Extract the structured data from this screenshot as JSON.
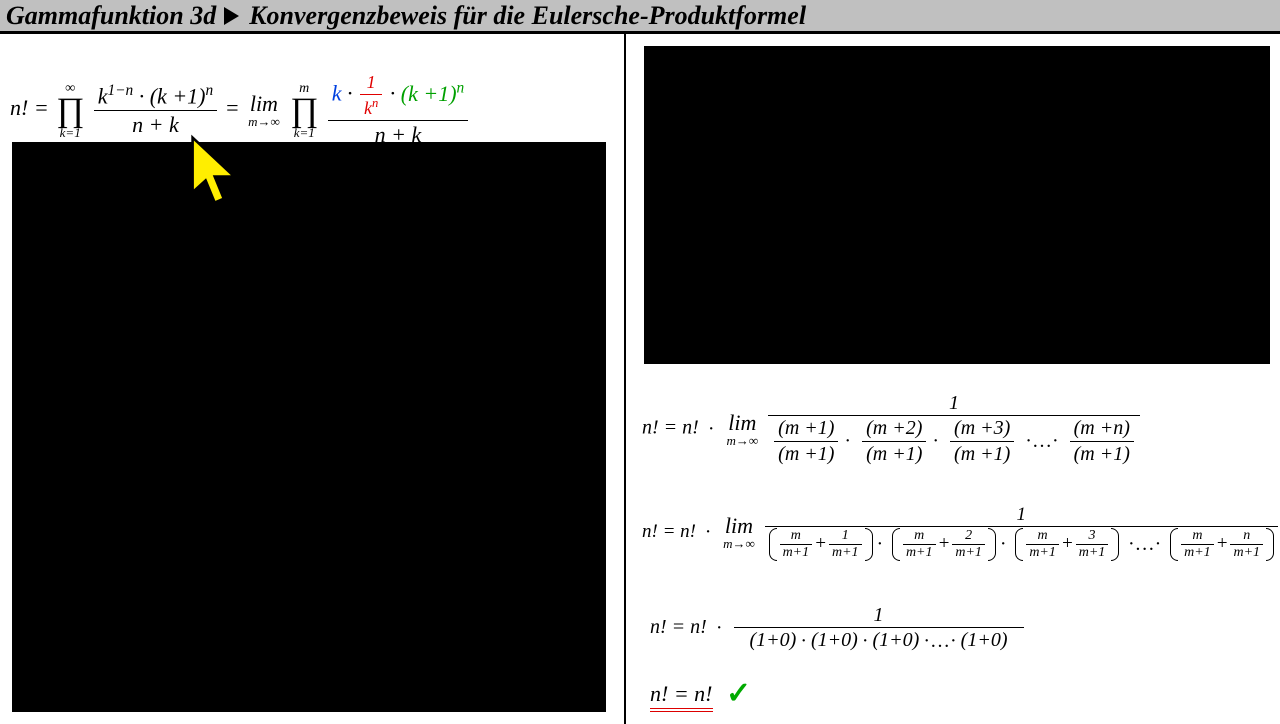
{
  "header": {
    "title_left": "Gammafunktion 3d",
    "title_right": "Konvergenzbeweis für die Eulersche-Produktformel"
  },
  "eq1": {
    "lhs": "n!",
    "prod1_top": "∞",
    "prod1_bot": "k=1",
    "f1_num_a": "k",
    "f1_num_exp1": "1−n",
    "f1_num_b": "(k +1)",
    "f1_num_exp2": "n",
    "f1_den": "n + k",
    "lim_top": "lim",
    "lim_bot": "m→∞",
    "prod2_top": "m",
    "prod2_bot": "k=1",
    "f2_k": "k",
    "f2_one": "1",
    "f2_kn": "k",
    "f2_kn_exp": "n",
    "f2_kp1": "(k +1)",
    "f2_kp1_exp": "n",
    "f2_den": "n + k"
  },
  "eq2": {
    "lhs": "n! = n!",
    "lim_top": "lim",
    "lim_bot": "m→∞",
    "num": "1",
    "t1n": "(m +1)",
    "t1d": "(m +1)",
    "t2n": "(m +2)",
    "t2d": "(m +1)",
    "t3n": "(m +3)",
    "t3d": "(m +1)",
    "dots": "·…·",
    "t4n": "(m +n)",
    "t4d": "(m +1)"
  },
  "eq3": {
    "lhs": "n! = n!",
    "lim_top": "lim",
    "lim_bot": "m→∞",
    "num": "1",
    "a_n": "m",
    "a_d": "m+1",
    "b1_n": "1",
    "b2_n": "2",
    "b3_n": "3",
    "bn_n": "n",
    "b_d": "m+1",
    "dots": "·…·"
  },
  "eq4": {
    "lhs": "n! = n!",
    "num": "1",
    "term": "(1+0)",
    "dots": "·…·"
  },
  "eq5": {
    "text": "n! = n!"
  }
}
